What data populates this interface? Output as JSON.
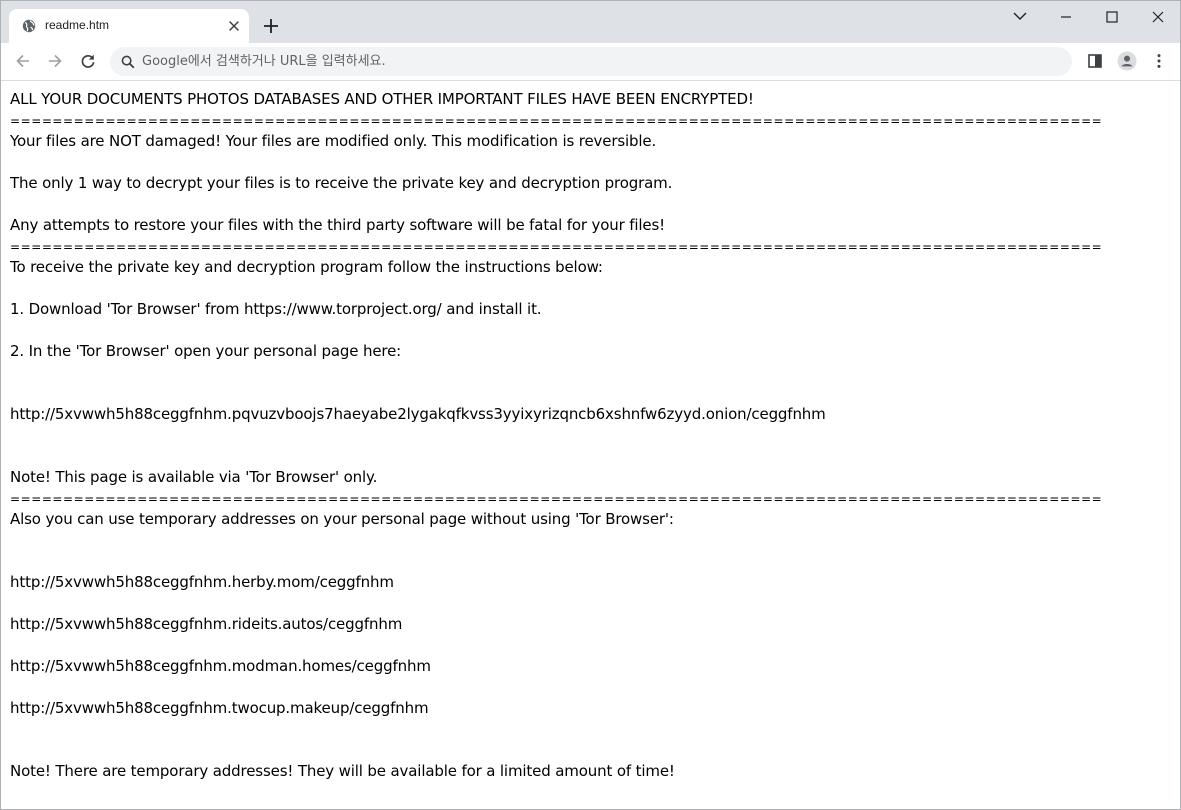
{
  "browser": {
    "tab_title": "readme.htm",
    "omnibox_placeholder": "Google에서 검색하거나 URL을 입력하세요."
  },
  "note": {
    "headline": "ALL YOUR DOCUMENTS PHOTOS DATABASES AND OTHER IMPORTANT FILES HAVE BEEN ENCRYPTED!",
    "separator": "=======================================================================================================",
    "line_not_damaged": "Your files are NOT damaged! Your files are modified only. This modification is reversible.",
    "line_only_way": "The only 1 way to decrypt your files is to receive the private key and decryption program.",
    "line_attempts": "Any attempts to restore your files with the third party software will be fatal for your files!",
    "line_instructions": "To receive the private key and decryption program follow the instructions below:",
    "step1": "1. Download 'Tor Browser' from https://www.torproject.org/ and install it.",
    "step2": "2. In the 'Tor Browser' open your personal page here:",
    "onion_url": "http://5xvwwh5h88ceggfnhm.pqvuzvboojs7haeyabe2lygakqfkvss3yyixyrizqncb6xshnfw6zyyd.onion/ceggfnhm",
    "note_tor_only": "Note! This page is available via 'Tor Browser' only.",
    "line_temp_addresses": "Also you can use temporary addresses on your personal page without using 'Tor Browser':",
    "temp_urls": [
      "http://5xvwwh5h88ceggfnhm.herby.mom/ceggfnhm",
      "http://5xvwwh5h88ceggfnhm.rideits.autos/ceggfnhm",
      "http://5xvwwh5h88ceggfnhm.modman.homes/ceggfnhm",
      "http://5xvwwh5h88ceggfnhm.twocup.makeup/ceggfnhm"
    ],
    "note_limited": "Note! There are temporary addresses! They will be available for a limited amount of time!"
  }
}
